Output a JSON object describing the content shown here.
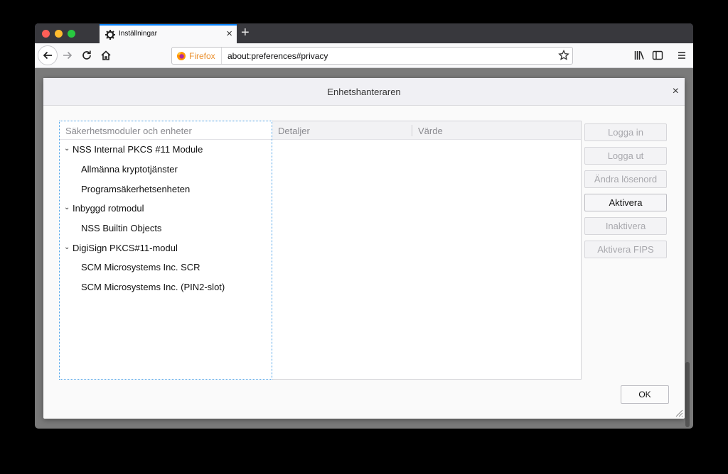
{
  "browser": {
    "tab_title": "Inställningar",
    "url_identity": "Firefox",
    "url": "about:preferences#privacy"
  },
  "dialog": {
    "title": "Enhetshanteraren",
    "tree_header": "Säkerhetsmoduler och enheter",
    "tree_items": [
      {
        "label": "NSS Internal PKCS #11 Module",
        "level": 0
      },
      {
        "label": "Allmänna kryptotjänster",
        "level": 1
      },
      {
        "label": "Programsäkerhetsenheten",
        "level": 1
      },
      {
        "label": "Inbyggd rotmodul",
        "level": 0
      },
      {
        "label": "NSS Builtin Objects",
        "level": 1
      },
      {
        "label": "DigiSign PKCS#11-modul",
        "level": 0
      },
      {
        "label": "SCM Microsystems Inc. SCR",
        "level": 1
      },
      {
        "label": "SCM Microsystems Inc. (PIN2-slot)",
        "level": 1
      }
    ],
    "details_columns": {
      "details": "Detaljer",
      "value": "Värde"
    },
    "buttons": {
      "login": "Logga in",
      "logout": "Logga ut",
      "change_password": "Ändra lösenord",
      "enable": "Aktivera",
      "disable": "Inaktivera",
      "enable_fips": "Aktivera FIPS"
    },
    "ok": "OK"
  },
  "colors": {
    "tab_accent": "#0a84ff",
    "firefox_orange": "#ea8f2c",
    "tree_focus": "#4aa0e8"
  }
}
